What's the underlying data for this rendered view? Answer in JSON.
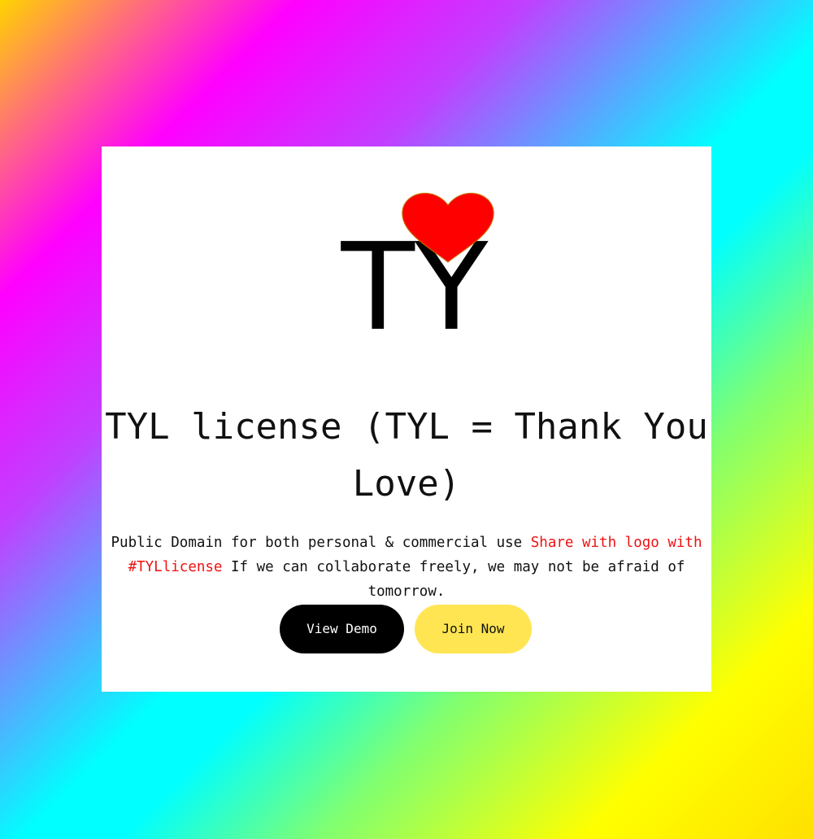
{
  "logo": {
    "text": "TY",
    "heart_color": "#ff0000",
    "heart_outline": "#cc6600",
    "icon": "heart-icon"
  },
  "title": "TYL license (TYL = Thank You Love)",
  "description": {
    "part1": "Public Domain for both personal & commercial use ",
    "highlight": "Share with logo with #TYLlicense",
    "part2": " If we can collaborate freely, we may not be afraid of tomorrow."
  },
  "buttons": {
    "demo_label": "View Demo",
    "join_label": "Join Now"
  },
  "colors": {
    "highlight": "#ee1111",
    "demo_bg": "#000000",
    "join_bg": "#ffe552",
    "card_bg": "#ffffff"
  }
}
